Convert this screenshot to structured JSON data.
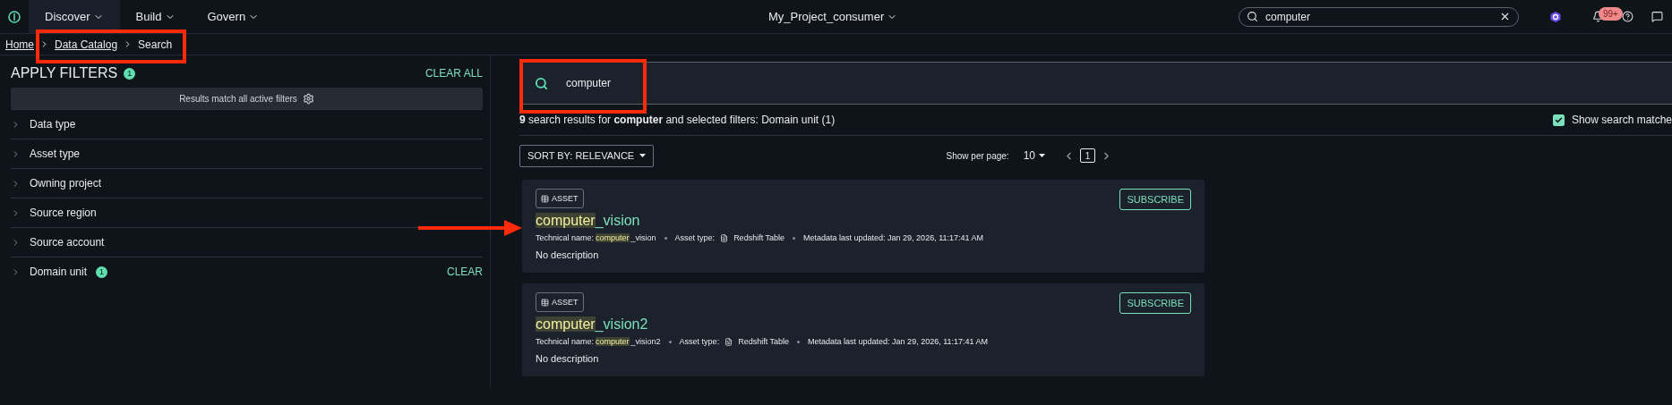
{
  "top_bar": {
    "nav": [
      {
        "label": "Discover",
        "selected": true
      },
      {
        "label": "Build",
        "selected": false
      },
      {
        "label": "Govern",
        "selected": false
      }
    ],
    "project": "My_Project_consumer",
    "search": {
      "value": "computer"
    },
    "notifications_badge": "99+"
  },
  "breadcrumbs": [
    "Home",
    "Data Catalog",
    "Search"
  ],
  "filters": {
    "title": "APPLY FILTERS",
    "count": "1",
    "clear_all": "CLEAR ALL",
    "match_note": "Results match all active filters",
    "items": [
      {
        "label": "Data type",
        "expanded": false
      },
      {
        "label": "Asset type",
        "expanded": false
      },
      {
        "label": "Owning project",
        "expanded": false
      },
      {
        "label": "Source region",
        "expanded": false
      },
      {
        "label": "Source account",
        "expanded": false
      },
      {
        "label": "Domain unit",
        "expanded": false,
        "count": "1",
        "clear": "CLEAR"
      }
    ]
  },
  "search": {
    "value": "computer"
  },
  "summary": "**9** search results for **computer** and selected filters: Domain unit (1)",
  "show_matches": {
    "label": "Show search matche",
    "checked": true
  },
  "sort": {
    "label": "SORT BY: RELEVANCE"
  },
  "pagination": {
    "per_page_label": "Show per page:",
    "per_page": "10",
    "pages": [
      {
        "label": "1",
        "selected": true
      }
    ]
  },
  "results": [
    {
      "badge": "ASSET",
      "title_match": "computer",
      "title_rest": "_vision",
      "subscribe": "SUBSCRIBE",
      "tech_label": "Technical name:",
      "tech_match": "computer",
      "tech_rest": "_vision",
      "type_label": "Asset type:",
      "type_value": "Redshift Table",
      "updated_label": "Metadata last updated:",
      "updated_value": "Jan 29, 2026, 11:17:41 AM",
      "description": "No description"
    },
    {
      "badge": "ASSET",
      "title_match": "computer",
      "title_rest": "_vision2",
      "subscribe": "SUBSCRIBE",
      "tech_label": "Technical name:",
      "tech_match": "computer",
      "tech_rest": "_vision2",
      "type_label": "Asset type:",
      "type_value": "Redshift Table",
      "updated_label": "Metadata last updated:",
      "updated_value": "Jan 29, 2026, 11:17:41 AM",
      "description": "No description"
    }
  ]
}
